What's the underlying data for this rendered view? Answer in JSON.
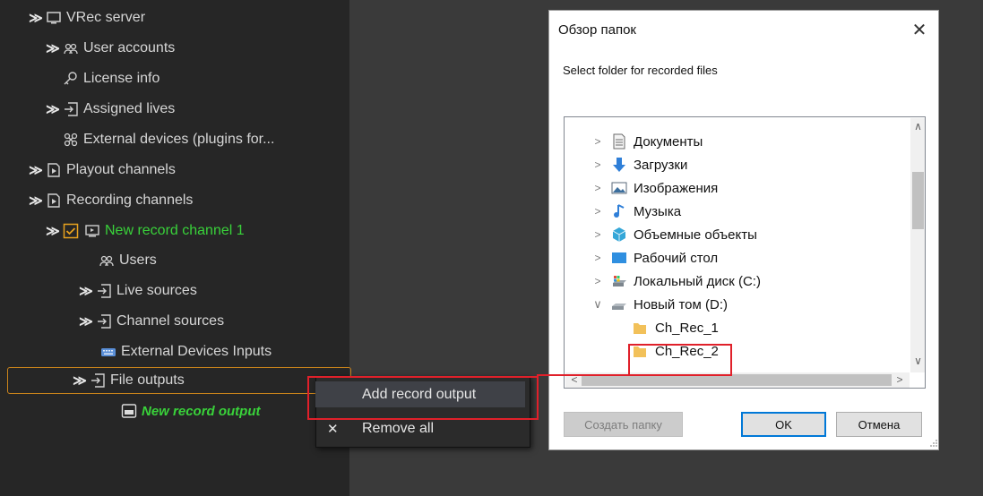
{
  "tree": {
    "root": "VRec server",
    "user_accounts": "User accounts",
    "license_info": "License info",
    "assigned_lives": "Assigned lives",
    "external_devices": "External devices (plugins for...",
    "playout_channels": "Playout channels",
    "recording_channels": "Recording channels",
    "new_record_channel": "New record channel 1",
    "users": "Users",
    "live_sources": "Live sources",
    "channel_sources": "Channel sources",
    "external_devices_inputs": "External Devices Inputs",
    "file_outputs": "File outputs",
    "new_record_output": "New record output"
  },
  "context_menu": {
    "add_record_output": "Add record output",
    "remove_all": "Remove all",
    "remove_icon": "✕"
  },
  "dialog": {
    "title": "Обзор папок",
    "close_glyph": "✕",
    "description": "Select folder for recorded files",
    "folders": [
      "Документы",
      "Загрузки",
      "Изображения",
      "Музыка",
      "Объемные объекты",
      "Рабочий стол",
      "Локальный диск (C:)",
      "Новый том (D:)",
      "Ch_Rec_1",
      "Ch_Rec_2"
    ],
    "buttons": {
      "new_folder": "Создать папку",
      "ok": "OK",
      "cancel": "Отмена"
    }
  },
  "colors": {
    "accent_green": "#39d23a",
    "selection_orange": "#c9831b",
    "highlight_red": "#e0202a",
    "ok_border": "#0078d7"
  },
  "icons": {
    "expand": "chevron-double-right-icon",
    "collapse": "chevron-double-down-icon",
    "server": "monitor-icon",
    "users": "users-group-icon",
    "license": "key-icon",
    "lives": "input-icon",
    "plugins": "plugin-icon",
    "channels": "document-icon",
    "checkbox": "checkbox-checked-icon"
  }
}
